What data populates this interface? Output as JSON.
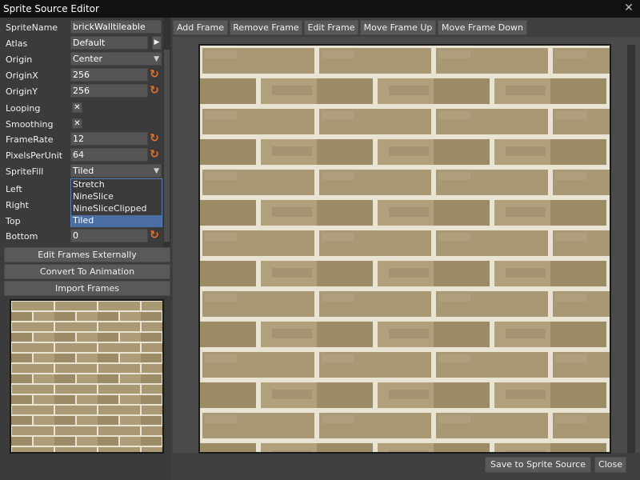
{
  "window": {
    "title": "Sprite Source Editor",
    "close_glyph": "✕"
  },
  "properties": {
    "sprite_name": {
      "label": "SpriteName",
      "value": "brickWalltileable"
    },
    "atlas": {
      "label": "Atlas",
      "value": "Default",
      "button_glyph": "▶"
    },
    "origin": {
      "label": "Origin",
      "value": "Center"
    },
    "origin_x": {
      "label": "OriginX",
      "value": "256"
    },
    "origin_y": {
      "label": "OriginY",
      "value": "256"
    },
    "looping": {
      "label": "Looping",
      "checked": true,
      "glyph": "✕"
    },
    "smoothing": {
      "label": "Smoothing",
      "checked": true,
      "glyph": "✕"
    },
    "frame_rate": {
      "label": "FrameRate",
      "value": "12"
    },
    "pixels_per_unit": {
      "label": "PixelsPerUnit",
      "value": "64"
    },
    "sprite_fill": {
      "label": "SpriteFill",
      "value": "Tiled"
    },
    "left": {
      "label": "Left"
    },
    "right": {
      "label": "Right"
    },
    "top": {
      "label": "Top"
    },
    "bottom": {
      "label": "Bottom",
      "value": "0"
    },
    "dropdown_arrow": "▼",
    "reset_icon": "↻"
  },
  "sprite_fill_options": [
    "Stretch",
    "NineSlice",
    "NineSliceClipped",
    "Tiled"
  ],
  "sprite_fill_selected": "Tiled",
  "actions": {
    "edit_externally": "Edit Frames Externally",
    "convert": "Convert To Animation",
    "import": "Import Frames"
  },
  "toolbar": {
    "add_frame": "Add Frame",
    "remove_frame": "Remove Frame",
    "edit_frame": "Edit Frame",
    "move_up": "Move Frame Up",
    "move_down": "Move Frame Down"
  },
  "footer": {
    "save": "Save to Sprite Source",
    "close": "Close"
  },
  "colors": {
    "brick": "#a89874",
    "brick_dark": "#8d7d5d",
    "mortar": "#e9e3d3",
    "accent_reset": "#e8702a",
    "selection": "#4a6ea3"
  }
}
